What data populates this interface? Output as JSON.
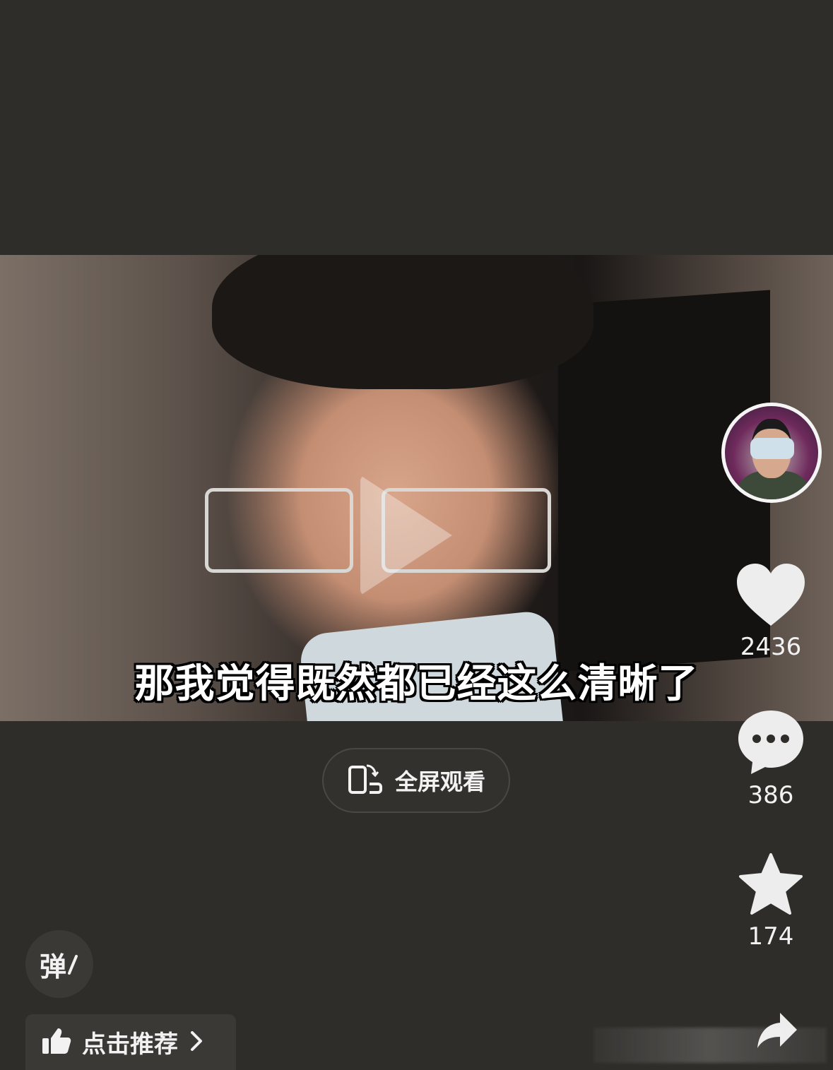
{
  "video": {
    "subtitle": "那我觉得既然都已经这么清晰了"
  },
  "fullscreen": {
    "label": "全屏观看",
    "icon": "rotate-screen-icon"
  },
  "actions": {
    "like": {
      "icon": "heart-icon",
      "count": "2436"
    },
    "comment": {
      "icon": "comment-bubble-icon",
      "count": "386"
    },
    "favorite": {
      "icon": "star-icon",
      "count": "174"
    },
    "share": {
      "icon": "share-arrow-icon"
    }
  },
  "danmu": {
    "label": "弹"
  },
  "recommend": {
    "label": "点击推荐",
    "icon": "thumbs-up-icon"
  },
  "colors": {
    "background": "#2f2d2a",
    "button_bg": "#3b3936",
    "text": "#ffffff"
  }
}
